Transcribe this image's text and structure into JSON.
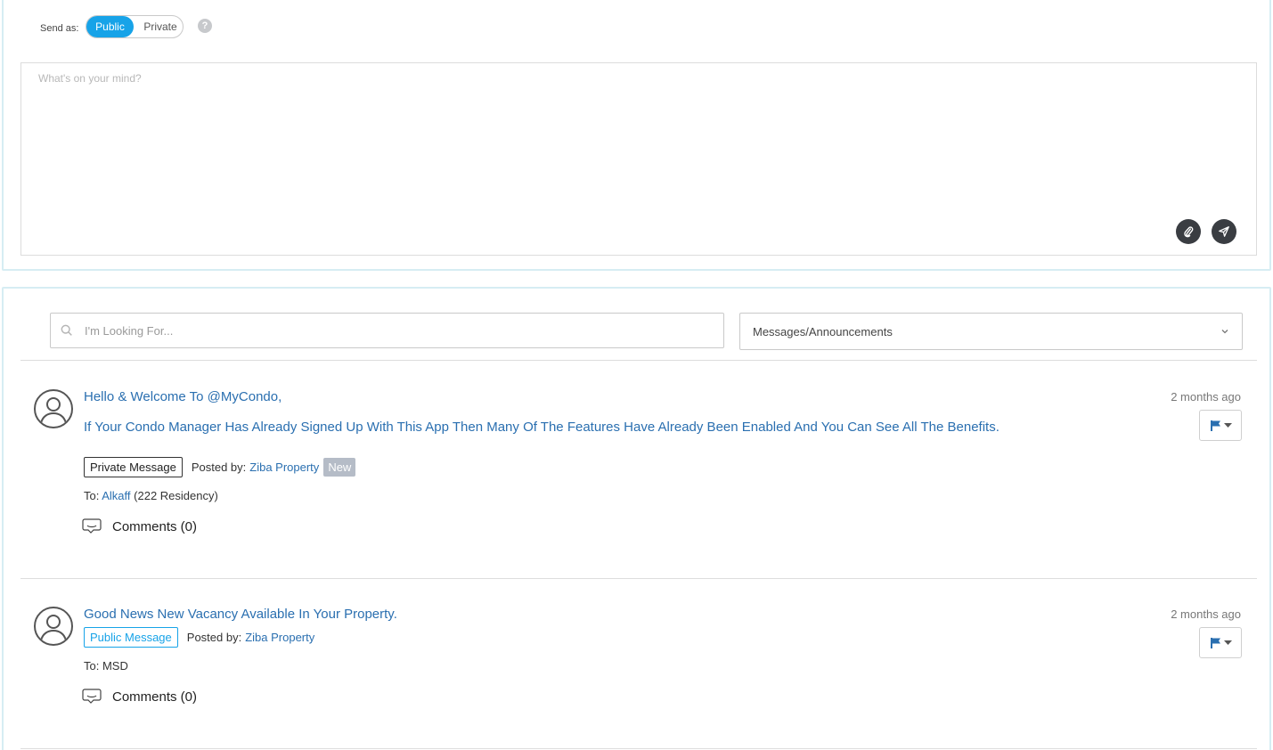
{
  "composer": {
    "send_as_label": "Send as:",
    "toggle_public": "Public",
    "toggle_private": "Private",
    "help": "?",
    "placeholder": "What's on your mind?"
  },
  "feed": {
    "search_placeholder": "I'm Looking For...",
    "filter_value": "Messages/Announcements",
    "posts": [
      {
        "title": "Hello & Welcome To @MyCondo,",
        "body": "If Your Condo Manager Has Already Signed Up With This App Then Many Of The Features Have Already Been Enabled And You Can See All The Benefits.",
        "timestamp": "2 months ago",
        "type_badge": "Private Message",
        "posted_by_label": "Posted by:",
        "poster": "Ziba Property",
        "new_badge": "New",
        "to_label": "To:",
        "recipient": "Alkaff",
        "recipient_suffix": "(222 Residency)",
        "comments": "Comments (0)"
      },
      {
        "title": "Good News New Vacancy Available In Your Property.",
        "timestamp": "2 months ago",
        "type_badge": "Public Message",
        "posted_by_label": "Posted by:",
        "poster": "Ziba Property",
        "to_text": "To: MSD",
        "comments": "Comments (0)"
      }
    ]
  },
  "colors": {
    "accent": "#17a3e8",
    "link": "#2a6fb0",
    "panel_border": "#d6edf3",
    "dark_button": "#3a3d42",
    "new_badge": "#b5bcc7"
  }
}
